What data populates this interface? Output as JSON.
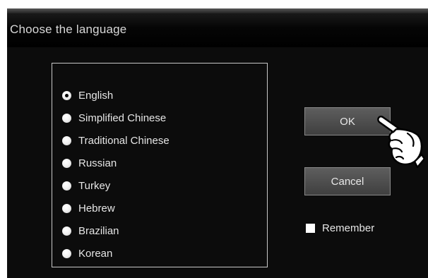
{
  "dialog": {
    "title": "Choose the language"
  },
  "languages": [
    {
      "label": "English",
      "selected": true
    },
    {
      "label": "Simplified Chinese",
      "selected": false
    },
    {
      "label": "Traditional Chinese",
      "selected": false
    },
    {
      "label": "Russian",
      "selected": false
    },
    {
      "label": "Turkey",
      "selected": false
    },
    {
      "label": "Hebrew",
      "selected": false
    },
    {
      "label": "Brazilian",
      "selected": false
    },
    {
      "label": "Korean",
      "selected": false
    }
  ],
  "buttons": {
    "ok_label": "OK",
    "cancel_label": "Cancel"
  },
  "remember": {
    "label": "Remember",
    "checked": false
  },
  "icons": {
    "cursor": "pointing-hand-icon"
  },
  "colors": {
    "dialog_bg": "#0c0c0c",
    "text": "#e6e6e6",
    "button_bg": "#4e4e4e",
    "border": "#c9c9c9"
  }
}
